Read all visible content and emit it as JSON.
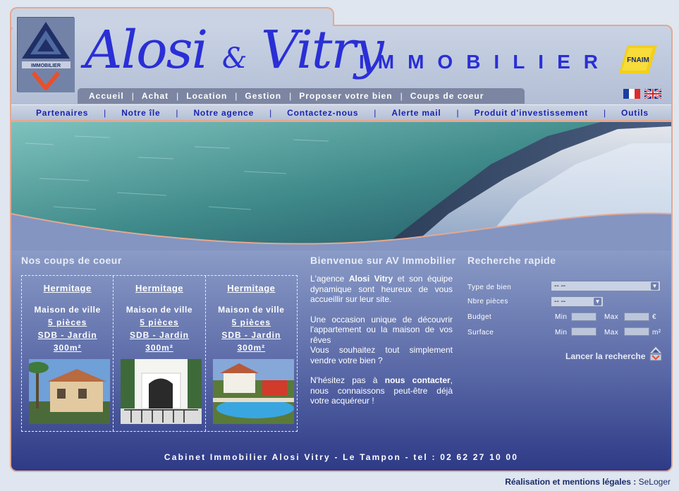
{
  "brand": {
    "name_a": "Alosi",
    "amp": "&",
    "name_b": "Vitry",
    "subtitle": "IMMOBILIER",
    "logo_text": "IMMOBILIER",
    "partner_logo_text": "FNAIM"
  },
  "main_menu": [
    "Accueil",
    "Achat",
    "Location",
    "Gestion",
    "Proposer votre bien",
    "Coups de coeur"
  ],
  "languages": [
    "fr-flag-icon",
    "uk-flag-icon"
  ],
  "sub_menu": [
    "Partenaires",
    "Notre île",
    "Notre agence",
    "Contactez-nous",
    "Alerte mail",
    "Produit d'investissement",
    "Outils"
  ],
  "coups_de_coeur": {
    "title": "Nos coups de coeur",
    "items": [
      {
        "location": "Hermitage",
        "type": "Maison de ville",
        "rooms": "5 pièces",
        "features": "SDB - Jardin",
        "area": "300m²"
      },
      {
        "location": "Hermitage",
        "type": "Maison de ville",
        "rooms": "5 pièces",
        "features": "SDB - Jardin",
        "area": "300m²"
      },
      {
        "location": "Hermitage",
        "type": "Maison de ville",
        "rooms": "5 pièces",
        "features": "SDB - Jardin",
        "area": "300m²"
      }
    ]
  },
  "welcome": {
    "title": "Bienvenue sur AV Immobilier",
    "p1_before": "L'agence ",
    "p1_bold": "Alosi Vitry",
    "p1_after": " et son équipe dynamique sont heureux de vous accueillir sur leur site.",
    "p2": "Une occasion unique de découvrir l'appartement ou la maison de vos rêves",
    "p3": "Vous souhaitez tout simplement vendre votre bien ?",
    "p4_before": "N'hésitez pas à ",
    "p4_bold": "nous contacter",
    "p4_after": ", nous connaissons peut-être déjà votre acquéreur !"
  },
  "search": {
    "title": "Recherche rapide",
    "type_label": "Type de bien",
    "type_value": "-- --",
    "rooms_label": "Nbre pièces",
    "rooms_value": "-- --",
    "budget_label": "Budget",
    "surface_label": "Surface",
    "min_label": "Min",
    "max_label": "Max",
    "budget_unit": "€",
    "surface_unit": "m²",
    "submit_label": "Lancer la recherche"
  },
  "footer": {
    "address": "Cabinet Immobilier Alosi Vitry - Le Tampon - tel : 02 62 27 10 00",
    "credits_bold": "Réalisation et mentions légales :",
    "credits_link": "SeLoger"
  },
  "colors": {
    "brand_blue": "#2a2fd6",
    "nav_blue": "#1b22b0",
    "border_salmon": "#e3a892",
    "content_top": "#8a9bc6",
    "content_bottom": "#2e3a86"
  }
}
